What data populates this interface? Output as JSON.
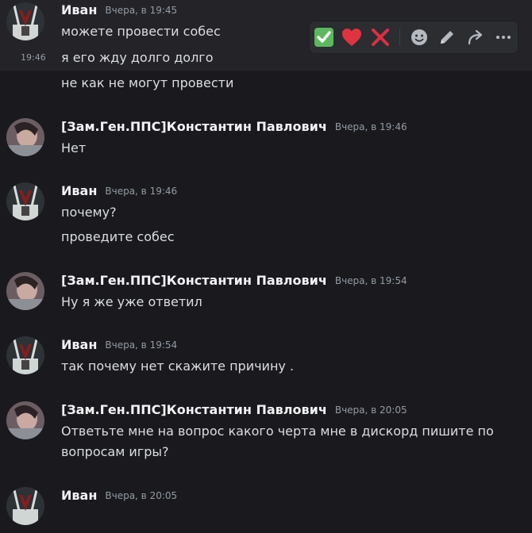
{
  "messages": [
    {
      "author": "Иван",
      "timestamp": "Вчера, в 19:45",
      "lines": [
        {
          "text": "можете провести собес"
        },
        {
          "text": "я его жду долго долго",
          "side_time": "19:46"
        },
        {
          "text": "не как не могут провести"
        }
      ]
    },
    {
      "author": "[Зам.Ген.ППС]Константин Павлович",
      "timestamp": "Вчера, в 19:46",
      "lines": [
        {
          "text": "Нет"
        }
      ]
    },
    {
      "author": "Иван",
      "timestamp": "Вчера, в 19:46",
      "lines": [
        {
          "text": "почему?"
        },
        {
          "text": "проведите собес"
        }
      ]
    },
    {
      "author": "[Зам.Ген.ППС]Константин Павлович",
      "timestamp": "Вчера, в 19:54",
      "lines": [
        {
          "text": "Ну я же уже ответил"
        }
      ]
    },
    {
      "author": "Иван",
      "timestamp": "Вчера, в 19:54",
      "lines": [
        {
          "text": "так почему нет скажите причину ."
        }
      ]
    },
    {
      "author": "[Зам.Ген.ППС]Константин Павлович",
      "timestamp": "Вчера, в 20:05",
      "lines": [
        {
          "text": "Ответьте мне на вопрос какого черта мне в дискорд  пишите по вопросам игры?"
        }
      ]
    },
    {
      "author": "Иван",
      "timestamp": "Вчера, в 20:05",
      "lines": []
    }
  ],
  "toolbar": {
    "icons": [
      "check-mark-reaction-icon",
      "heart-reaction-icon",
      "cross-mark-reaction-icon",
      "add-reaction-icon",
      "edit-icon",
      "forward-icon",
      "more-icon"
    ],
    "colors": {
      "check": "#5cb85c",
      "heart": "#e03340",
      "cross": "#dd2e44"
    }
  }
}
